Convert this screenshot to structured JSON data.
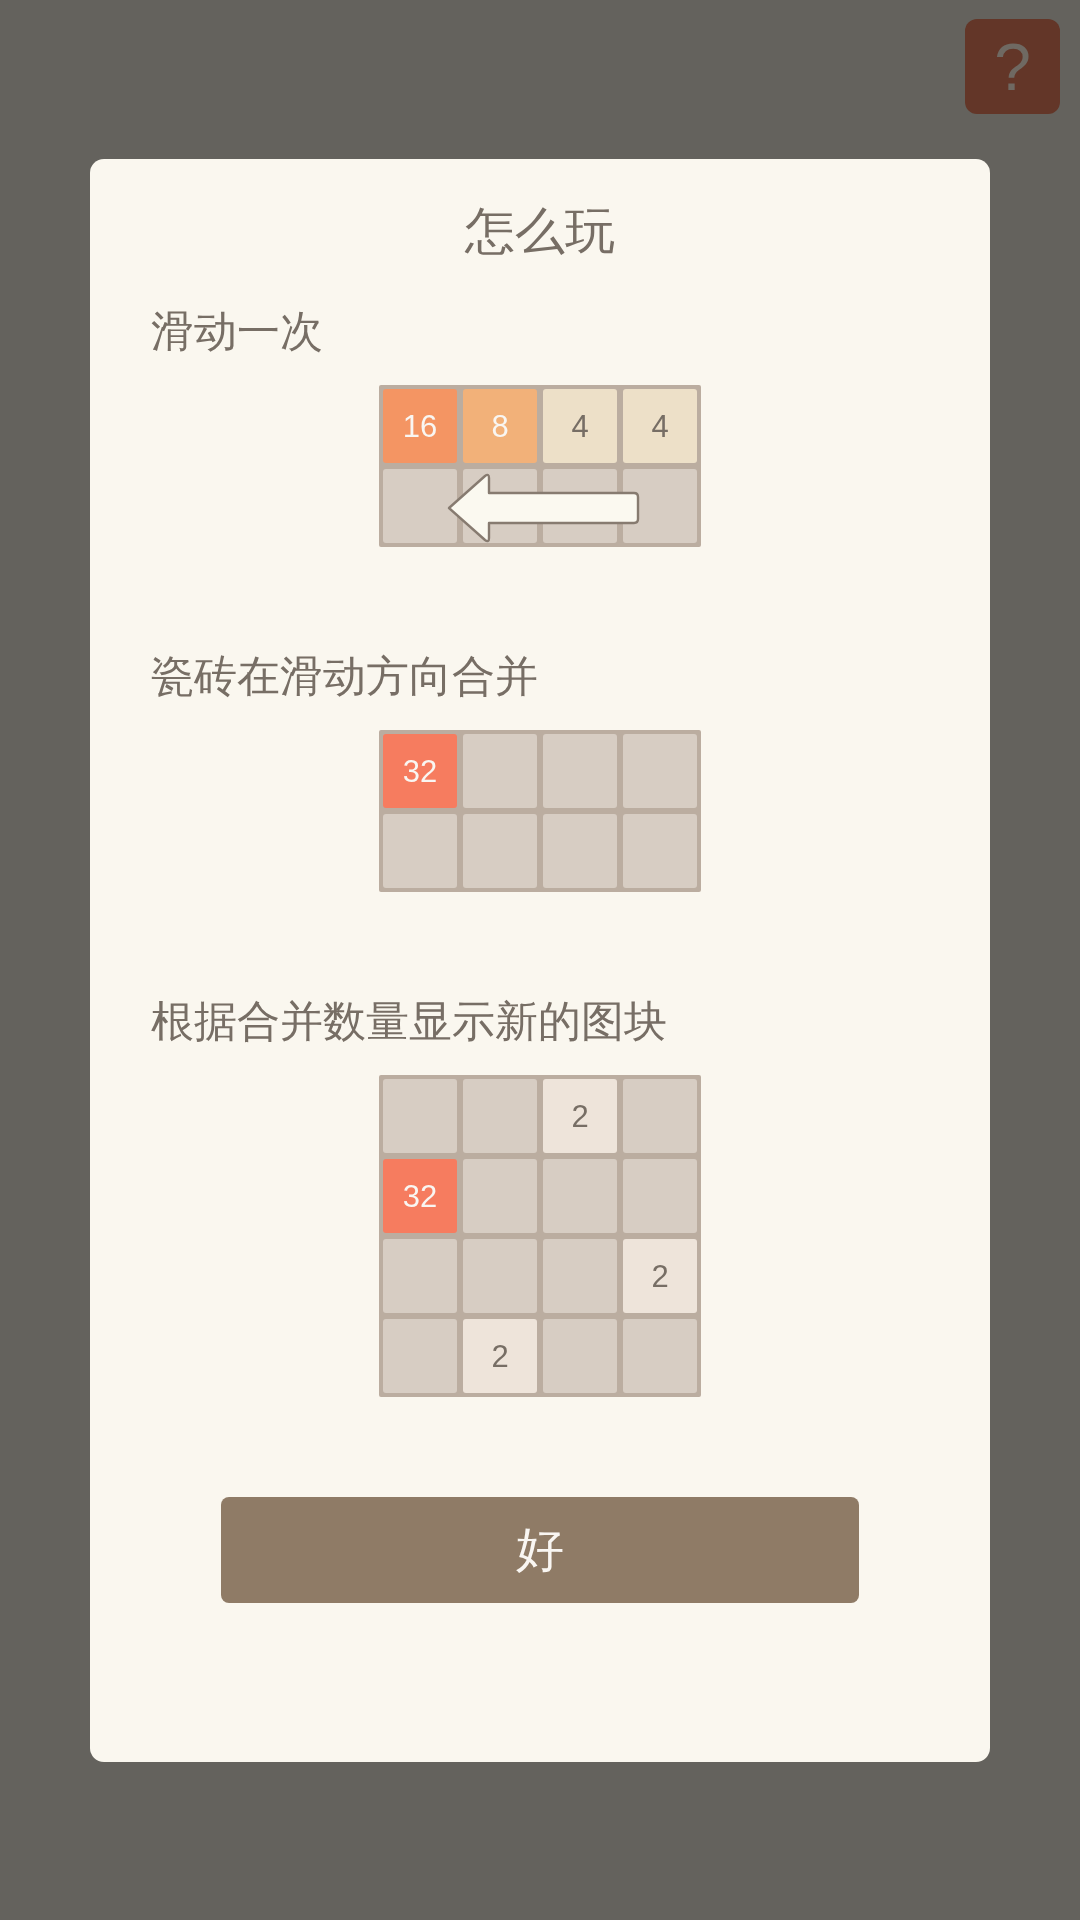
{
  "help_button": {
    "label": "?"
  },
  "dialog": {
    "title": "怎么玩",
    "sections": [
      {
        "caption": "滑动一次",
        "arrow": true,
        "tiles": [
          [
            {
              "kind": "number",
              "value": "16",
              "color": "#f49563"
            },
            {
              "kind": "number",
              "value": "8",
              "color": "#f2b179"
            },
            {
              "kind": "number",
              "value": "4",
              "color": "#ede0c8"
            },
            {
              "kind": "number",
              "value": "4",
              "color": "#ede0c8"
            }
          ],
          [
            {
              "kind": "empty"
            },
            {
              "kind": "empty"
            },
            {
              "kind": "empty"
            },
            {
              "kind": "empty"
            }
          ]
        ]
      },
      {
        "caption": "瓷砖在滑动方向合并",
        "tiles": [
          [
            {
              "kind": "number",
              "value": "32",
              "color": "#f67c5f"
            },
            {
              "kind": "empty"
            },
            {
              "kind": "empty"
            },
            {
              "kind": "empty"
            }
          ],
          [
            {
              "kind": "empty"
            },
            {
              "kind": "empty"
            },
            {
              "kind": "empty"
            },
            {
              "kind": "empty"
            }
          ]
        ]
      },
      {
        "caption": "根据合并数量显示新的图块",
        "tiles": [
          [
            {
              "kind": "empty"
            },
            {
              "kind": "empty"
            },
            {
              "kind": "number",
              "value": "2",
              "color": "#eee4da"
            },
            {
              "kind": "empty"
            }
          ],
          [
            {
              "kind": "number",
              "value": "32",
              "color": "#f67c5f"
            },
            {
              "kind": "empty"
            },
            {
              "kind": "empty"
            },
            {
              "kind": "empty"
            }
          ],
          [
            {
              "kind": "empty"
            },
            {
              "kind": "empty"
            },
            {
              "kind": "empty"
            },
            {
              "kind": "number",
              "value": "2",
              "color": "#eee4da"
            }
          ],
          [
            {
              "kind": "empty"
            },
            {
              "kind": "number",
              "value": "2",
              "color": "#eee4da"
            },
            {
              "kind": "empty"
            },
            {
              "kind": "empty"
            }
          ]
        ]
      }
    ],
    "ok_button": "好"
  }
}
